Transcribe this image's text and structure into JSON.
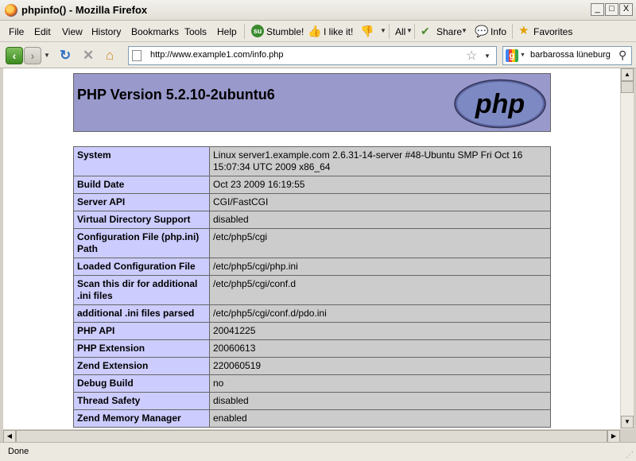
{
  "window": {
    "title": "phpinfo() - Mozilla Firefox",
    "buttons": {
      "minimize": "_",
      "maximize": "□",
      "close": "X"
    }
  },
  "menu": {
    "items": [
      "File",
      "Edit",
      "View",
      "History",
      "Bookmarks",
      "Tools",
      "Help"
    ],
    "stumble": "Stumble!",
    "like": "I like it!",
    "all": "All",
    "share": "Share",
    "info": "Info",
    "favorites": "Favorites"
  },
  "navigation": {
    "url": "http://www.example1.com/info.php",
    "search_value": "barbarossa lüneburg"
  },
  "page": {
    "php_title": "PHP Version 5.2.10-2ubuntu6",
    "logo_text": "php",
    "rows": [
      {
        "key": "System",
        "value": "Linux server1.example.com 2.6.31-14-server #48-Ubuntu SMP Fri Oct 16 15:07:34 UTC 2009 x86_64"
      },
      {
        "key": "Build Date",
        "value": "Oct 23 2009 16:19:55"
      },
      {
        "key": "Server API",
        "value": "CGI/FastCGI"
      },
      {
        "key": "Virtual Directory Support",
        "value": "disabled"
      },
      {
        "key": "Configuration File (php.ini) Path",
        "value": "/etc/php5/cgi"
      },
      {
        "key": "Loaded Configuration File",
        "value": "/etc/php5/cgi/php.ini"
      },
      {
        "key": "Scan this dir for additional .ini files",
        "value": "/etc/php5/cgi/conf.d"
      },
      {
        "key": "additional .ini files parsed",
        "value": "/etc/php5/cgi/conf.d/pdo.ini"
      },
      {
        "key": "PHP API",
        "value": "20041225"
      },
      {
        "key": "PHP Extension",
        "value": "20060613"
      },
      {
        "key": "Zend Extension",
        "value": "220060519"
      },
      {
        "key": "Debug Build",
        "value": "no"
      },
      {
        "key": "Thread Safety",
        "value": "disabled"
      },
      {
        "key": "Zend Memory Manager",
        "value": "enabled"
      }
    ]
  },
  "status": {
    "text": "Done"
  },
  "colors": {
    "php_header": "#9999cc",
    "row_key": "#ccccff",
    "row_value": "#cccccc",
    "logo_fill": "#6e7cb8"
  }
}
